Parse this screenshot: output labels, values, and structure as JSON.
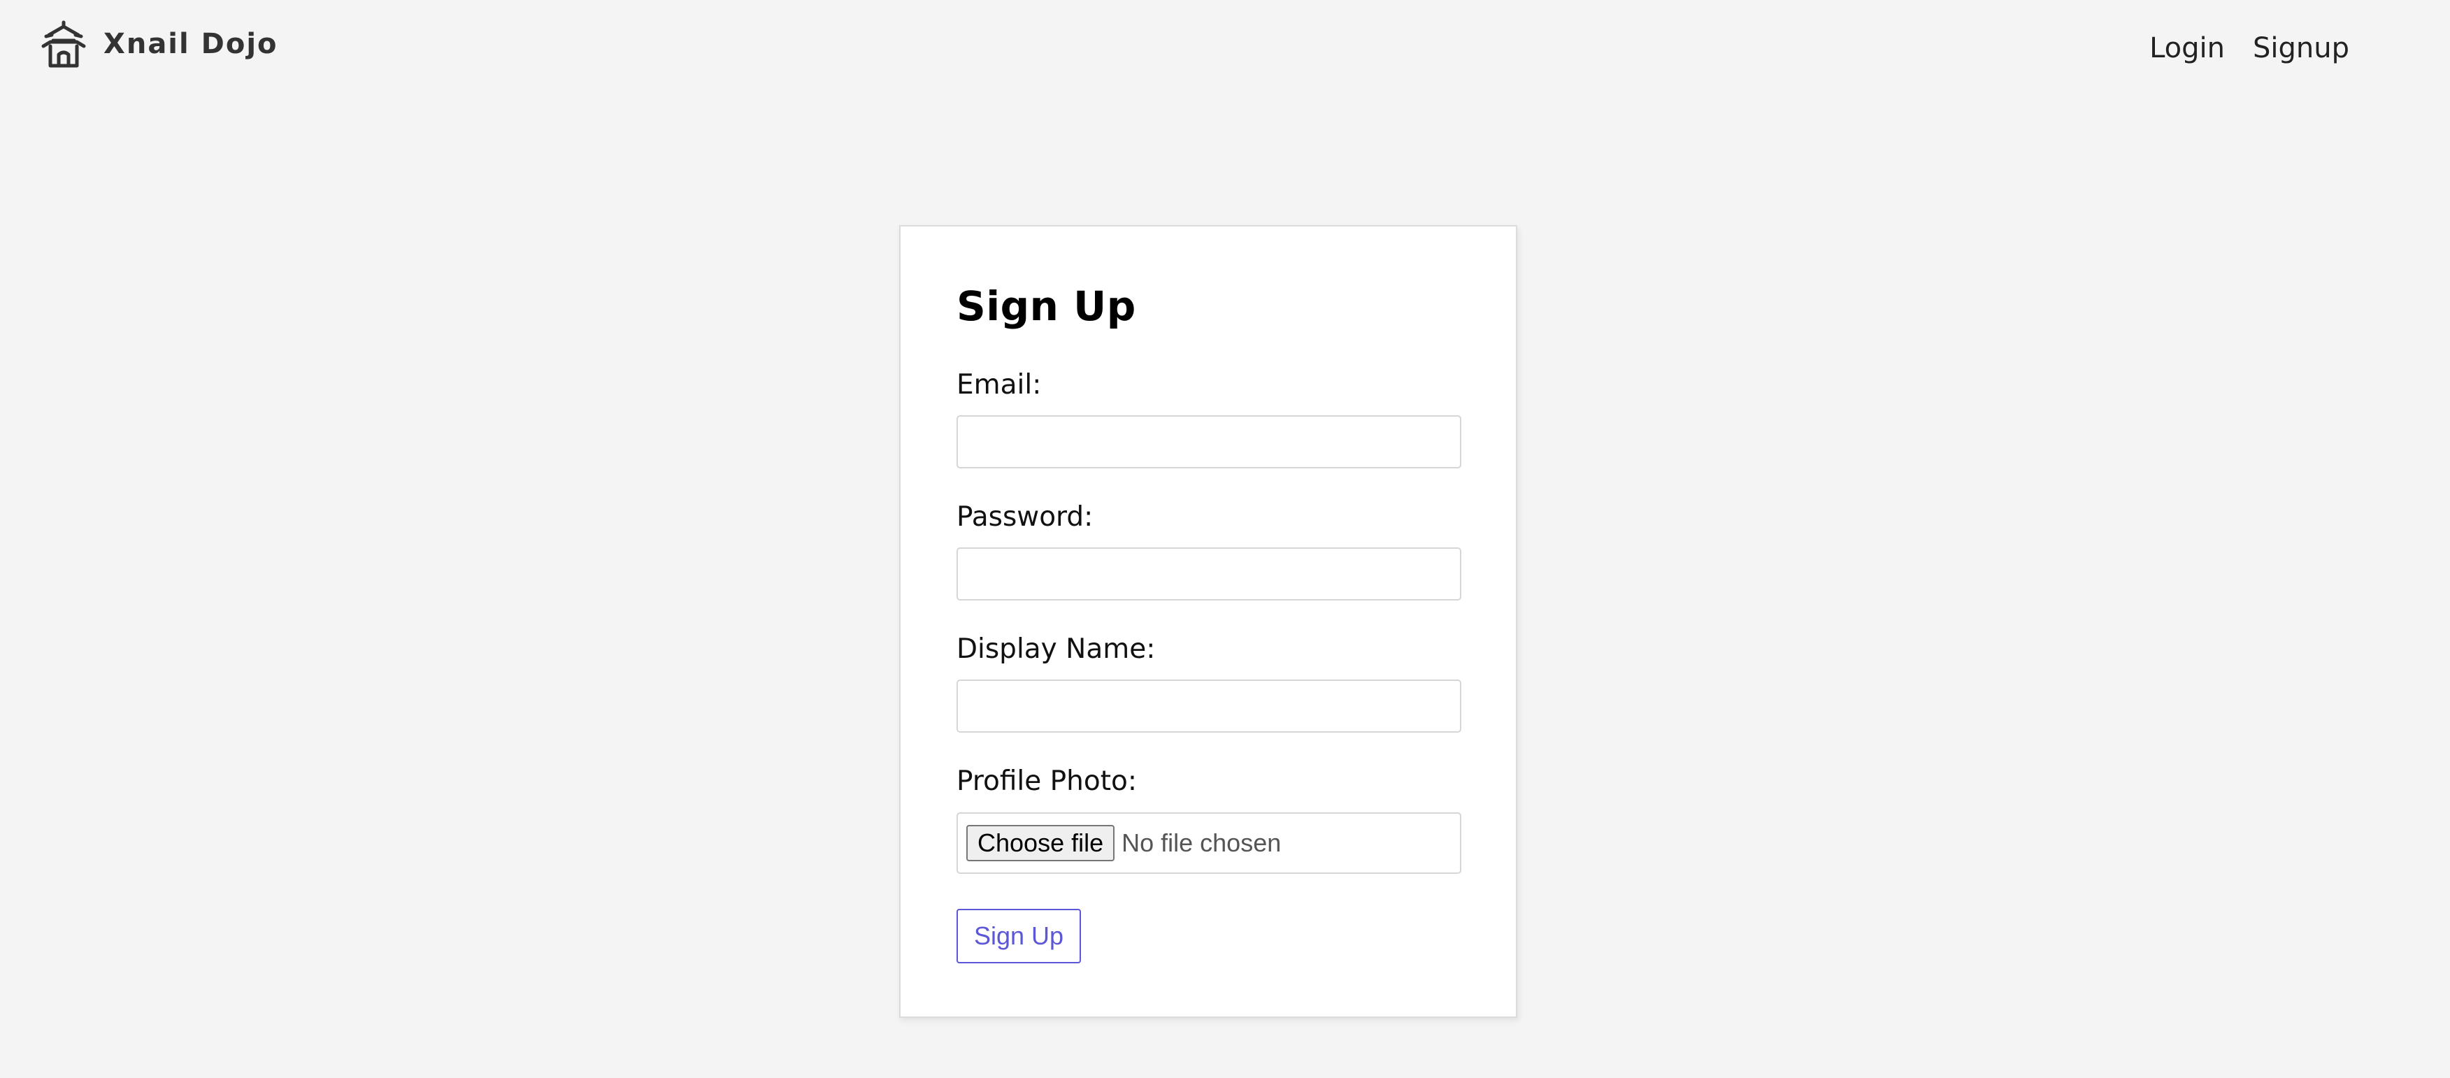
{
  "header": {
    "brand_name": "Xnail Dojo",
    "brand_icon": "dojo-temple-icon",
    "nav": {
      "login": "Login",
      "signup": "Signup"
    }
  },
  "form": {
    "title": "Sign Up",
    "fields": {
      "email": {
        "label": "Email:",
        "value": "",
        "placeholder": ""
      },
      "password": {
        "label": "Password:",
        "value": "",
        "placeholder": ""
      },
      "display_name": {
        "label": "Display Name:",
        "value": "",
        "placeholder": ""
      }
    },
    "profile_photo": {
      "label": "Profile Photo:",
      "button_label": "Choose file",
      "status": "No file chosen"
    },
    "submit_label": "Sign Up"
  },
  "colors": {
    "background": "#f4f4f4",
    "card": "#ffffff",
    "accent": "#5b57d6",
    "brand_text": "#333333"
  }
}
